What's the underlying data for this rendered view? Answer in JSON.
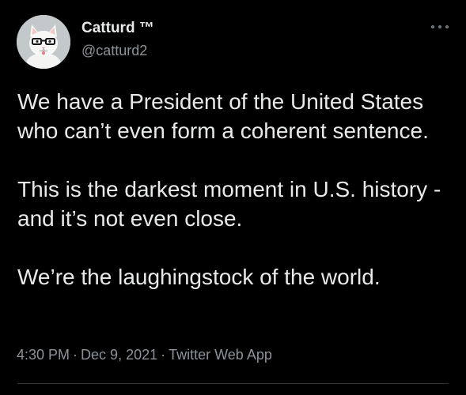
{
  "author": {
    "display_name": "Catturd ™",
    "handle": "@catturd2",
    "avatar_icon": "cat-with-glasses-avatar"
  },
  "tweet": {
    "paragraphs": [
      "We have a President of the United States who can’t even form a coherent sentence.",
      "This is the darkest moment in U.S. history - and it’s not even close.",
      "We’re the laughingstock of the world."
    ]
  },
  "meta": {
    "time": "4:30 PM",
    "separator": "·",
    "date": "Dec 9, 2021",
    "source": "Twitter Web App"
  },
  "colors": {
    "background": "#000000",
    "primary_text": "#e7e9ea",
    "secondary_text": "#8b9299",
    "divider": "#2f3336"
  },
  "icons": {
    "more": "more-horizontal-icon"
  }
}
